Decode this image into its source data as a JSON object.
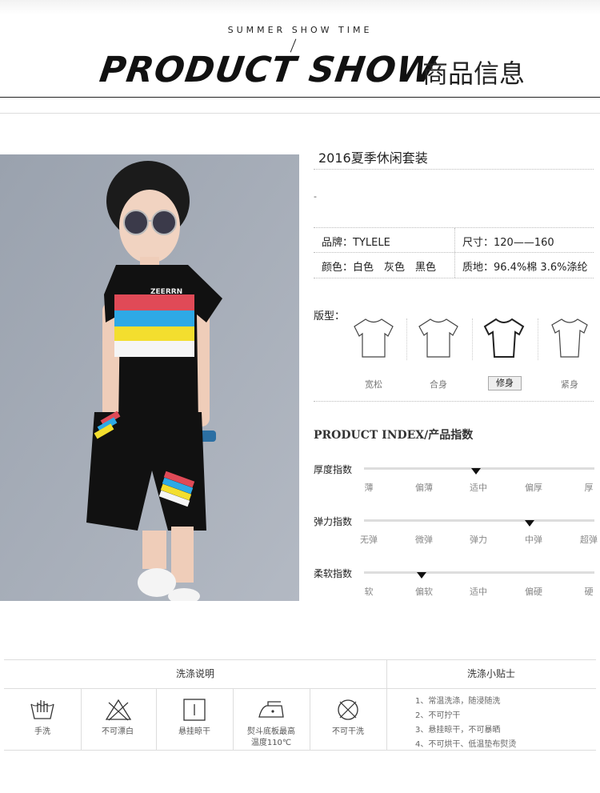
{
  "header": {
    "subtitle": "SUMMER SHOW TIME",
    "big_title": "PRODUCT SHOW",
    "cn_title": "商品信息"
  },
  "product": {
    "title": "2016夏季休闲套装",
    "dash": "-",
    "brand": "品牌：TYLELE",
    "size": "尺寸：120——160",
    "color": "颜色：白色　灰色　黑色",
    "material": "质地：96.4%棉 3.6%涤纶"
  },
  "fit": {
    "label": "版型：",
    "options": [
      "宽松",
      "合身",
      "修身",
      "紧身"
    ],
    "selected_index": 2
  },
  "product_index": {
    "title": "PRODUCT INDEX/产品指数",
    "rows": [
      {
        "label": "厚度指数",
        "ticks": [
          "薄",
          "偏薄",
          "适中",
          "偏厚",
          "厚"
        ],
        "level": 0.5
      },
      {
        "label": "弹力指数",
        "ticks": [
          "无弹",
          "微弹",
          "弹力",
          "中弹",
          "超弹"
        ],
        "level": 0.75
      },
      {
        "label": "柔软指数",
        "ticks": [
          "软",
          "偏软",
          "适中",
          "偏硬",
          "硬"
        ],
        "level": 0.25
      }
    ]
  },
  "wash": {
    "left_header": "洗涤说明",
    "right_header": "洗涤小贴士",
    "icons": [
      {
        "name": "hand-wash-icon",
        "label": "手洗"
      },
      {
        "name": "no-bleach-icon",
        "label": "不可漂白"
      },
      {
        "name": "hang-dry-icon",
        "label": "悬挂晾干"
      },
      {
        "name": "iron-icon",
        "label": "熨斗底板最高\n温度110℃"
      },
      {
        "name": "no-dry-clean-icon",
        "label": "不可干洗"
      }
    ],
    "tips": [
      "1、常温洗涤，随浸随洗",
      "2、不可拧干",
      "3、悬挂晾干，不可暴晒",
      "4、不可烘干、低温垫布熨烫"
    ]
  }
}
